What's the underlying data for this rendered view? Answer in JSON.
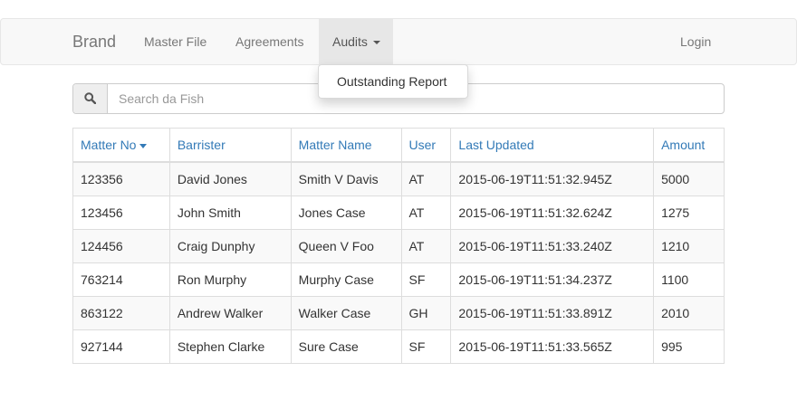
{
  "navbar": {
    "brand": "Brand",
    "links": [
      "Master File",
      "Agreements"
    ],
    "audits_label": "Audits",
    "login": "Login"
  },
  "dropdown": {
    "items": [
      "Outstanding Report"
    ]
  },
  "search": {
    "placeholder": "Search da Fish",
    "value": ""
  },
  "table": {
    "headers": [
      "Matter No",
      "Barrister",
      "Matter Name",
      "User",
      "Last Updated",
      "Amount"
    ],
    "rows": [
      [
        "123356",
        "David Jones",
        "Smith V Davis",
        "AT",
        "2015-06-19T11:51:32.945Z",
        "5000"
      ],
      [
        "123456",
        "John Smith",
        "Jones Case",
        "AT",
        "2015-06-19T11:51:32.624Z",
        "1275"
      ],
      [
        "124456",
        "Craig Dunphy",
        "Queen V Foo",
        "AT",
        "2015-06-19T11:51:33.240Z",
        "1210"
      ],
      [
        "763214",
        "Ron Murphy",
        "Murphy Case",
        "SF",
        "2015-06-19T11:51:34.237Z",
        "1100"
      ],
      [
        "863122",
        "Andrew Walker",
        "Walker Case",
        "GH",
        "2015-06-19T11:51:33.891Z",
        "2010"
      ],
      [
        "927144",
        "Stephen Clarke",
        "Sure Case",
        "SF",
        "2015-06-19T11:51:33.565Z",
        "995"
      ]
    ]
  },
  "colors": {
    "link": "#337ab7",
    "navbar_bg": "#f8f8f8",
    "active_nav_bg": "#e7e7e7"
  },
  "icons": {
    "search": "search-icon",
    "caret": "caret-down-icon"
  }
}
